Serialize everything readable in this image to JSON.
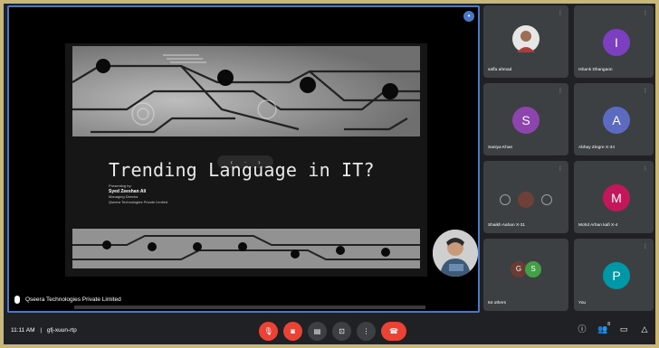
{
  "slide": {
    "title": "Trending Language in IT?",
    "presenting_by": "Presenting by:",
    "presenter": "Syed Zeeshan Ali",
    "role": "Managing Director",
    "company": "Qseera Technologies Private Limited"
  },
  "stage": {
    "caption": "Qseera Technologies Private Limited"
  },
  "participants": [
    {
      "name": "saffa ahmad",
      "initial": "",
      "color": "#3c4043"
    },
    {
      "name": "Ishank Dhangaon",
      "initial": "I",
      "color": "#7b3fbf"
    },
    {
      "name": "Saniya Khan",
      "initial": "S",
      "color": "#8e44ad"
    },
    {
      "name": "Abhay Zingre X-34",
      "initial": "A",
      "color": "#5c6bc0"
    },
    {
      "name": "Shaikh Aahan X-31",
      "initial": "",
      "color": "#3c4043"
    },
    {
      "name": "Mohd Arhan kafi X-4",
      "initial": "M",
      "color": "#c2185b"
    },
    {
      "name": "64 others",
      "initial": "",
      "color": "#3c4043"
    },
    {
      "name": "You",
      "initial": "P",
      "color": "#0097a7"
    }
  ],
  "others_initials": [
    "G",
    "S"
  ],
  "bottom_bar": {
    "time": "11:11 AM",
    "separator": "|",
    "meeting_code": "gfj-xuun-rtp",
    "participant_count": "8"
  },
  "icons": {
    "mic": "mic-off-icon",
    "camera": "camera-off-icon",
    "captions": "captions-icon",
    "present": "present-icon",
    "more": "more-icon",
    "end": "end-call-icon",
    "info": "info-icon",
    "people": "people-icon",
    "chat": "chat-icon",
    "activities": "activities-icon"
  }
}
